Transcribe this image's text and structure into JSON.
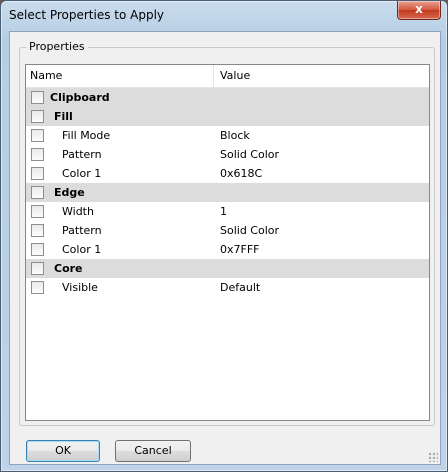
{
  "window": {
    "title": "Select Properties to Apply",
    "close_label": "x"
  },
  "group": {
    "legend": "Properties"
  },
  "list": {
    "columns": [
      "Name",
      "Value"
    ],
    "rows": [
      {
        "name": "Clipboard",
        "value": "",
        "level": 0,
        "is_group": true
      },
      {
        "name": "Fill",
        "value": "",
        "level": 1,
        "is_group": true
      },
      {
        "name": "Fill Mode",
        "value": "Block",
        "level": 2,
        "is_group": false
      },
      {
        "name": "Pattern",
        "value": "Solid Color",
        "level": 2,
        "is_group": false
      },
      {
        "name": "Color 1",
        "value": "0x618C",
        "level": 2,
        "is_group": false
      },
      {
        "name": "Edge",
        "value": "",
        "level": 1,
        "is_group": true
      },
      {
        "name": "Width",
        "value": "1",
        "level": 2,
        "is_group": false
      },
      {
        "name": "Pattern",
        "value": "Solid Color",
        "level": 2,
        "is_group": false
      },
      {
        "name": "Color 1",
        "value": "0x7FFF",
        "level": 2,
        "is_group": false
      },
      {
        "name": "Core",
        "value": "",
        "level": 1,
        "is_group": true
      },
      {
        "name": "Visible",
        "value": "Default",
        "level": 2,
        "is_group": false
      }
    ]
  },
  "buttons": {
    "ok": "OK",
    "cancel": "Cancel"
  }
}
